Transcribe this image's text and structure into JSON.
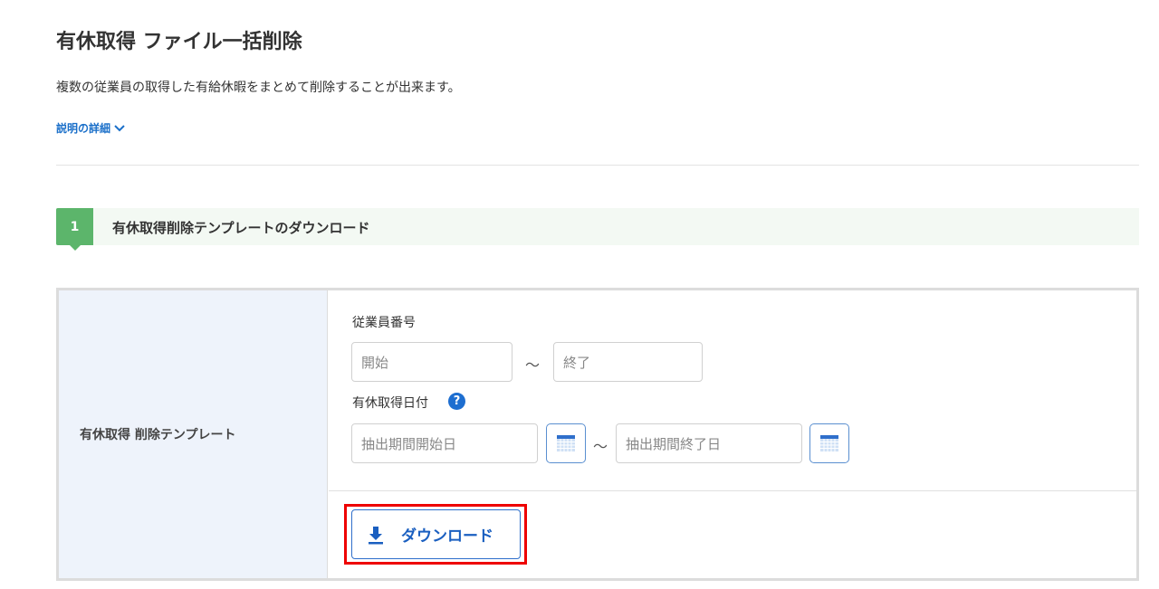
{
  "page": {
    "title": "有休取得 ファイル一括削除",
    "description": "複数の従業員の取得した有給休暇をまとめて削除することが出来ます。",
    "details_link": "説明の詳細"
  },
  "step": {
    "number": "1",
    "title": "有休取得削除テンプレートのダウンロード"
  },
  "form": {
    "row_label": "有休取得 削除テンプレート",
    "employee_number_label": "従業員番号",
    "employee_start_placeholder": "開始",
    "employee_end_placeholder": "終了",
    "range_separator": "～",
    "date_label": "有休取得日付",
    "help_icon": "?",
    "date_start_placeholder": "抽出期間開始日",
    "date_end_placeholder": "抽出期間終了日",
    "download_label": "ダウンロード"
  },
  "colors": {
    "accent": "#1a6fc9",
    "step_green": "#5cb56b",
    "highlight": "#ee0000"
  }
}
